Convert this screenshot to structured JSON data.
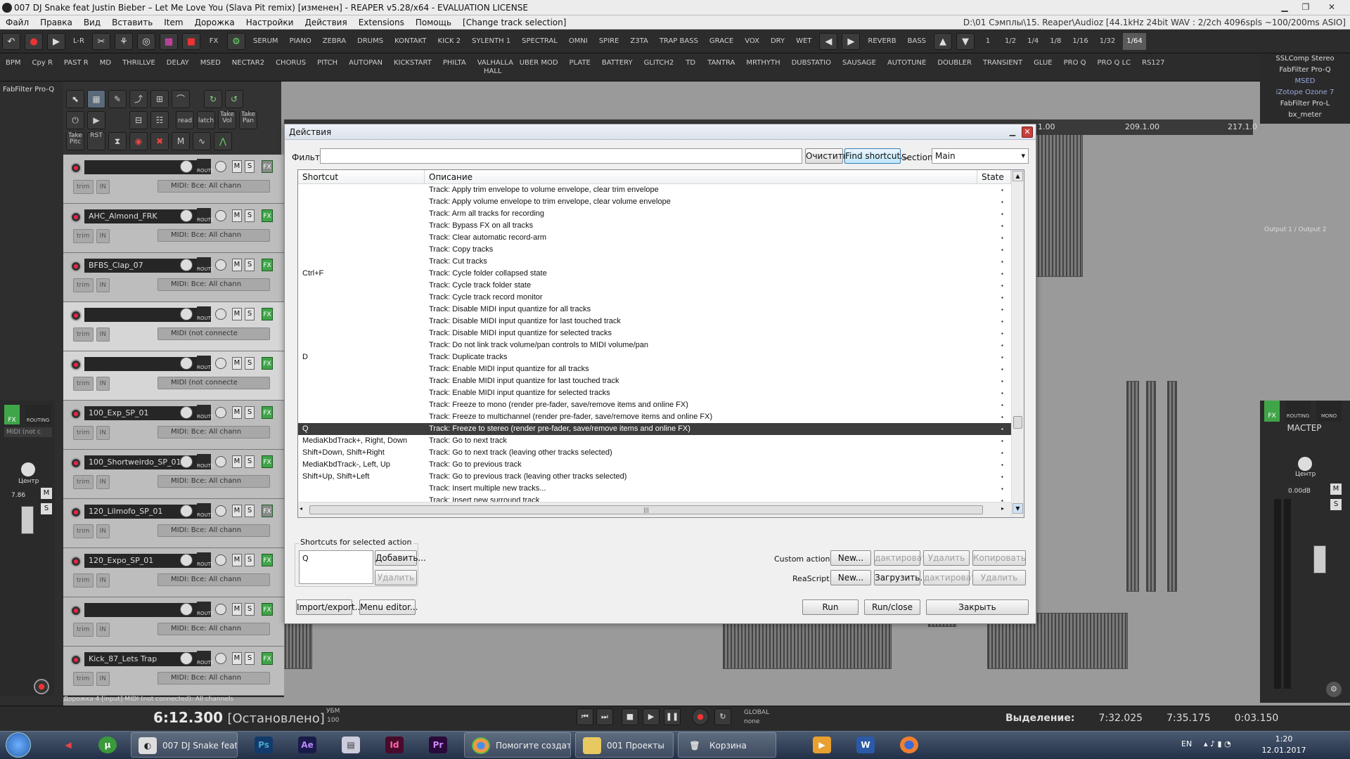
{
  "window": {
    "title": "007 DJ Snake feat Justin Bieber – Let Me Love You (Slava Pit remix) [изменен] - REAPER v5.28/x64 - EVALUATION LICENSE"
  },
  "menu": {
    "items": [
      "Файл",
      "Правка",
      "Вид",
      "Вставить",
      "Item",
      "Дорожка",
      "Настройки",
      "Действия",
      "Extensions",
      "Помощь",
      "[Change track selection]"
    ],
    "path": "D:\\01 Сэмплы\\15. Reaper\\Audioz [44.1kHz 24bit WAV : 2/2ch 4096spls ~100/200ms ASIO]"
  },
  "toolbar1": {
    "labels": [
      "L-R",
      "FX",
      "SERUM",
      "PIANO",
      "ZEBRA",
      "DRUMS",
      "KONTAKT",
      "KICK 2",
      "SYLENTH 1",
      "SPECTRAL",
      "OMNI",
      "SPIRE",
      "Z3TA",
      "TRAP BASS",
      "GRACE",
      "VOX",
      "DRY",
      "WET",
      "REVERB",
      "BASS",
      "1",
      "1/2",
      "1/4",
      "1/8",
      "1/16",
      "1/32",
      "1/64"
    ]
  },
  "toolbar2": {
    "labels": [
      "BPM",
      "Cpy R",
      "PAST R",
      "MD",
      "THRILLVE",
      "DELAY",
      "MSED",
      "NECTAR2",
      "CHORUS",
      "PITCH",
      "AUTOPAN",
      "KICKSTART",
      "PHILTA",
      "VALHALLA HALL",
      "UBER MOD",
      "PLATE",
      "BATTERY",
      "GLITCH2",
      "TD",
      "TANTRA",
      "MRTHYTH",
      "DUBSTATIO",
      "SAUSAGE",
      "AUTOTUNE",
      "DOUBLER",
      "TRANSIENT",
      "GLUE",
      "PRO Q",
      "PRO Q LC",
      "RS127"
    ]
  },
  "fxchain": [
    "SSLComp Stereo",
    "FabFilter Pro-Q",
    "MSED",
    "iZotope Ozone 7",
    "FabFilter Pro-L",
    "bx_meter"
  ],
  "leftpanel": {
    "fx_label": "FabFilter Pro-Q"
  },
  "editbar": {
    "labels": [
      "read",
      "latch",
      "Take Vol",
      "Take Pan",
      "Take Pitc",
      "RST"
    ]
  },
  "tracks": [
    {
      "name": "",
      "input": "MIDI: Все: All chann",
      "fx_on": false
    },
    {
      "name": "AHC_Almond_FRK",
      "input": "MIDI: Все: All chann",
      "fx_on": true
    },
    {
      "name": "BFBS_Clap_07",
      "input": "MIDI: Все: All chann",
      "fx_on": true
    },
    {
      "name": "",
      "input": "MIDI (not connecte",
      "fx_on": true
    },
    {
      "name": "",
      "input": "MIDI (not connecte",
      "fx_on": true
    },
    {
      "name": "100_Exp_SP_01",
      "input": "MIDI: Все: All chann",
      "fx_on": true
    },
    {
      "name": "100_Shortweirdo_SP_01",
      "input": "MIDI: Все: All chann",
      "fx_on": true
    },
    {
      "name": "120_Lilmofo_SP_01",
      "input": "MIDI: Все: All chann",
      "fx_on": false
    },
    {
      "name": "120_Expo_SP_01",
      "input": "MIDI: Все: All chann",
      "fx_on": true
    },
    {
      "name": "",
      "input": "MIDI: Все: All chann",
      "fx_on": true
    },
    {
      "name": "Kick_87_Lets Trap",
      "input": "MIDI: Все: All chann",
      "fx_on": true
    }
  ],
  "track_labels": {
    "trim": "trim",
    "in": "IN",
    "m": "M",
    "s": "S",
    "fx": "FX",
    "route": "ROUTE"
  },
  "ruler": {
    "marks": [
      "1.00",
      "209.1.00",
      "217.1.0"
    ]
  },
  "track_number": "11",
  "mixer": {
    "output": "Output 1 / Output 2",
    "master": "МАСТЕР",
    "center": "Центр",
    "db": "0.00dB",
    "routing": "ROUTING",
    "mono": "MONO",
    "left_center": "Центр",
    "left_db": "7.86",
    "left_midi": "MIDI (not c"
  },
  "statusline": "Дорожка 4 [input] MIDI (not connected): All channels",
  "transport": {
    "time": "6:12.300",
    "state": "[Остановлено]",
    "ubm": "УБМ",
    "bpm": "100",
    "global": "GLOBAL",
    "none": "none"
  },
  "selection": {
    "label": "Выделение:",
    "start": "7:32.025",
    "end": "7:35.175",
    "length": "0:03.150"
  },
  "dialog": {
    "title": "Действия",
    "filter_label": "Фильт:",
    "filter_value": "",
    "clear_btn": "Очистить",
    "find_btn": "Find shortcut...",
    "section_label": "Section:",
    "section_value": "Main",
    "col_shortcut": "Shortcut",
    "col_desc": "Описание",
    "col_state": "State",
    "rows": [
      {
        "sc": "",
        "d": "Track: Apply trim envelope to volume envelope, clear trim envelope"
      },
      {
        "sc": "",
        "d": "Track: Apply volume envelope to trim envelope, clear volume envelope"
      },
      {
        "sc": "",
        "d": "Track: Arm all tracks for recording"
      },
      {
        "sc": "",
        "d": "Track: Bypass FX on all tracks"
      },
      {
        "sc": "",
        "d": "Track: Clear automatic record-arm"
      },
      {
        "sc": "",
        "d": "Track: Copy tracks"
      },
      {
        "sc": "",
        "d": "Track: Cut tracks"
      },
      {
        "sc": "Ctrl+F",
        "d": "Track: Cycle folder collapsed state"
      },
      {
        "sc": "",
        "d": "Track: Cycle track folder state"
      },
      {
        "sc": "",
        "d": "Track: Cycle track record monitor"
      },
      {
        "sc": "",
        "d": "Track: Disable MIDI input quantize for all tracks"
      },
      {
        "sc": "",
        "d": "Track: Disable MIDI input quantize for last touched track"
      },
      {
        "sc": "",
        "d": "Track: Disable MIDI input quantize for selected tracks"
      },
      {
        "sc": "",
        "d": "Track: Do not link track volume/pan controls to MIDI volume/pan"
      },
      {
        "sc": "D",
        "d": "Track: Duplicate tracks"
      },
      {
        "sc": "",
        "d": "Track: Enable MIDI input quantize for all tracks"
      },
      {
        "sc": "",
        "d": "Track: Enable MIDI input quantize for last touched track"
      },
      {
        "sc": "",
        "d": "Track: Enable MIDI input quantize for selected tracks"
      },
      {
        "sc": "",
        "d": "Track: Freeze to mono (render pre-fader, save/remove items and online FX)"
      },
      {
        "sc": "",
        "d": "Track: Freeze to multichannel (render pre-fader, save/remove items and online FX)"
      },
      {
        "sc": "Q",
        "d": "Track: Freeze to stereo (render pre-fader, save/remove items and online FX)",
        "sel": true
      },
      {
        "sc": "MediaKbdTrack+, Right, Down",
        "d": "Track: Go to next track"
      },
      {
        "sc": "Shift+Down, Shift+Right",
        "d": "Track: Go to next track (leaving other tracks selected)"
      },
      {
        "sc": "MediaKbdTrack-, Left, Up",
        "d": "Track: Go to previous track"
      },
      {
        "sc": "Shift+Up, Shift+Left",
        "d": "Track: Go to previous track (leaving other tracks selected)"
      },
      {
        "sc": "",
        "d": "Track: Insert multiple new tracks..."
      },
      {
        "sc": "",
        "d": "Track: Insert new surround track"
      },
      {
        "sc": "",
        "d": "Track: Insert new surround track, using selected tracks as source audio"
      }
    ],
    "shortcuts_group": "Shortcuts for selected action",
    "shortcut_value": "Q",
    "add_btn": "Добавить...",
    "remove_btn": "Удалить",
    "custom_label": "Custom actions:",
    "custom_new": "New...",
    "custom_edit": "дактировать",
    "custom_delete": "Удалить",
    "custom_copy": "Копировать",
    "reascript_label": "ReaScript:",
    "rs_new": "New...",
    "rs_load": "Загрузить...",
    "rs_edit": "дактироват",
    "rs_delete": "Удалить",
    "import_btn": "Import/export...",
    "menu_editor_btn": "Menu editor...",
    "run_btn": "Run",
    "runclose_btn": "Run/close",
    "close_btn": "Закрыть"
  },
  "taskbar": {
    "items": [
      "007 DJ Snake feat ...",
      "Помогите создат...",
      "001 Проекты",
      "Корзина"
    ],
    "apps": [
      "Ps",
      "Ae",
      "Id",
      "Pr",
      "W"
    ],
    "lang": "EN",
    "time": "1:20",
    "date": "12.01.2017"
  }
}
